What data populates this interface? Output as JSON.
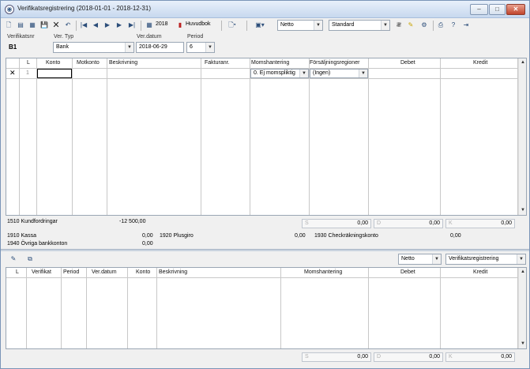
{
  "window": {
    "title": "Verifikatsregistrering (2018-01-01 - 2018-12-31)",
    "minimize": "–",
    "maximize": "□",
    "close": "✕"
  },
  "toolbar": {
    "year": "2018",
    "huvudbok": "Huvudbok",
    "mode_value": "Netto",
    "view_value": "Standard"
  },
  "form": {
    "verifikatsnr_label": "Verifikatsnr",
    "verifikatsnr_value": "B1",
    "ver_typ_label": "Ver. Typ",
    "ver_typ_value": "Bank",
    "ver_datum_label": "Ver.datum",
    "ver_datum_value": "2018-06-29",
    "period_label": "Period",
    "period_value": "6"
  },
  "entry_grid": {
    "headers": [
      "L",
      "Konto",
      "Motkonto",
      "Beskrivning",
      "Fakturanr.",
      "Momshantering",
      "Försäljningsregioner",
      "Debet",
      "Kredit"
    ],
    "row": {
      "marker": "✕",
      "line": "1",
      "konto": "",
      "moms": "0. Ej momspliktig",
      "region": "(Ingen)"
    }
  },
  "balances": {
    "kundfordringar_label": "1510 Kundfordringar",
    "kundfordringar_value": "-12 500,00",
    "kassa_label": "1910 Kassa",
    "kassa_value": "0,00",
    "plusgiro_label": "1920 Plusgiro",
    "plusgiro_value": "0,00",
    "checkkonto_label": "1930 Checkräkningskonto",
    "checkkonto_value": "0,00",
    "ovriga_label": "1940 Övriga bankkonton",
    "ovriga_value": "0,00"
  },
  "totals_top": {
    "s_prefix": "S",
    "s_value": "0,00",
    "d_prefix": "D",
    "d_value": "0,00",
    "k_prefix": "K",
    "k_value": "0,00"
  },
  "lower": {
    "mode_value": "Netto",
    "view_value": "Verifikatsregistrering",
    "headers": [
      "L",
      "Verifikat",
      "Period",
      "Ver.datum",
      "Konto",
      "Beskrivning",
      "Momshantering",
      "Debet",
      "Kredit"
    ]
  },
  "totals_bottom": {
    "s_prefix": "S",
    "s_value": "0,00",
    "d_prefix": "D",
    "d_value": "0,00",
    "k_prefix": "K",
    "k_value": "0,00"
  },
  "icons": {
    "app": "ledger-icon",
    "new": "new-document-icon",
    "save": "save-icon",
    "delete": "delete-icon",
    "undo": "undo-icon",
    "first": "first-record-icon",
    "prev": "previous-record-icon",
    "next": "next-record-icon",
    "last": "last-record-icon",
    "calendar": "calendar-icon",
    "book": "book-icon"
  }
}
